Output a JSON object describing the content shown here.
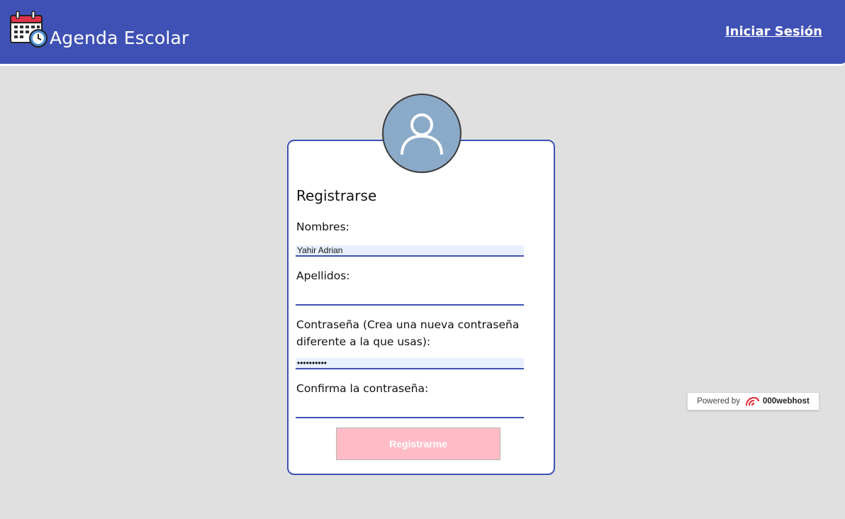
{
  "header": {
    "app_icon": "calendar-clock-icon",
    "title": "Agenda Escolar",
    "login_link": "Iniciar Sesión",
    "color": "#3f51b5"
  },
  "form": {
    "avatar_icon": "user-icon",
    "title": "Registrarse",
    "fields": {
      "first_name": {
        "label": "Nombres:",
        "value": "Yahir Adrian"
      },
      "last_name": {
        "label": "Apellidos:",
        "value": ""
      },
      "password": {
        "label": "Contraseña (Crea una nueva contraseña diferente a la que usas):",
        "value": "••••••••••"
      },
      "confirm_password": {
        "label": "Confirma la contraseña:",
        "value": ""
      }
    },
    "submit_label": "Registrarme",
    "submit_color": "#ffbcc6"
  },
  "badge": {
    "prefix": "Powered by",
    "logo_icon": "000webhost-logo-icon",
    "brand": "000webhost"
  }
}
